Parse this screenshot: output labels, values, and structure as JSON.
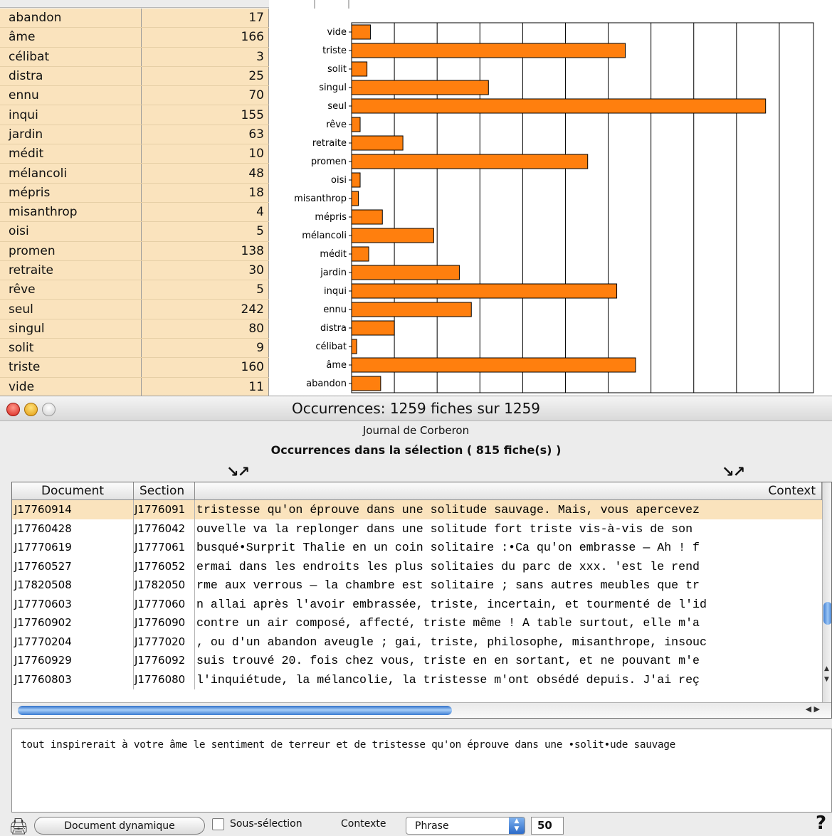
{
  "word_table": [
    {
      "word": "abandon",
      "count": "17"
    },
    {
      "word": "âme",
      "count": "166"
    },
    {
      "word": "célibat",
      "count": "3"
    },
    {
      "word": "distra",
      "count": "25"
    },
    {
      "word": "ennu",
      "count": "70"
    },
    {
      "word": "inqui",
      "count": "155"
    },
    {
      "word": "jardin",
      "count": "63"
    },
    {
      "word": "médit",
      "count": "10"
    },
    {
      "word": "mélancoli",
      "count": "48"
    },
    {
      "word": "mépris",
      "count": "18"
    },
    {
      "word": "misanthrop",
      "count": "4"
    },
    {
      "word": "oisi",
      "count": "5"
    },
    {
      "word": "promen",
      "count": "138"
    },
    {
      "word": "retraite",
      "count": "30"
    },
    {
      "word": "rêve",
      "count": "5"
    },
    {
      "word": "seul",
      "count": "242"
    },
    {
      "word": "singul",
      "count": "80"
    },
    {
      "word": "solit",
      "count": "9"
    },
    {
      "word": "triste",
      "count": "160"
    },
    {
      "word": "vide",
      "count": "11"
    }
  ],
  "chart_data": {
    "type": "bar",
    "orientation": "horizontal",
    "categories": [
      "vide",
      "triste",
      "solit",
      "singul",
      "seul",
      "rêve",
      "retraite",
      "promen",
      "oisi",
      "misanthrop",
      "mépris",
      "mélancoli",
      "médit",
      "jardin",
      "inqui",
      "ennu",
      "distra",
      "célibat",
      "âme",
      "abandon"
    ],
    "values": [
      11,
      160,
      9,
      80,
      242,
      5,
      30,
      138,
      5,
      4,
      18,
      48,
      10,
      63,
      155,
      70,
      25,
      3,
      166,
      17
    ],
    "xlim": [
      0,
      270
    ],
    "grid": true,
    "bar_color": "#ff7f0e"
  },
  "window": {
    "title": "Occurrences: 1259 fiches sur 1259",
    "subtitle": "Journal de Corberon",
    "heading": "Occurrences dans la sélection ( 815 fiche(s) )",
    "sort_arrows": "↘↗"
  },
  "grid": {
    "headers": {
      "document": "Document",
      "section": "Section",
      "context": "Context"
    },
    "rows": [
      {
        "document": "J17760914",
        "section": "J1776091",
        "context": "tristesse qu'on éprouve dans une solitude sauvage. Mais, vous apercevez"
      },
      {
        "document": "J17760428",
        "section": "J1776042",
        "context": "ouvelle va la replonger dans une solitude fort triste vis-à-vis de son"
      },
      {
        "document": "J17770619",
        "section": "J1777061",
        "context": "busqué•Surprit Thalie en un coin solitaire :•Ca qu'on embrasse — Ah ! f"
      },
      {
        "document": "J17760527",
        "section": "J1776052",
        "context": "ermai dans les endroits les plus solitaies du parc de xxx. 'est le rend"
      },
      {
        "document": "J17820508",
        "section": "J1782050",
        "context": "rme aux verrous — la chambre est solitaire ; sans autres meubles que tr"
      },
      {
        "document": "J17770603",
        "section": "J1777060",
        "context": "n allai après l'avoir embrassée, triste, incertain, et tourmenté de l'id"
      },
      {
        "document": "J17760902",
        "section": "J1776090",
        "context": " contre un air composé, affecté, triste même ! A table surtout, elle m'a"
      },
      {
        "document": "J17770204",
        "section": "J1777020",
        "context": ", ou d'un abandon aveugle ; gai, triste, philosophe, misanthrope, insouc"
      },
      {
        "document": "J17760929",
        "section": "J1776092",
        "context": " suis trouvé 20. fois chez vous, triste en en sortant, et ne pouvant m'e"
      },
      {
        "document": "J17760803",
        "section": "J1776080",
        "context": " l'inquiétude, la mélancolie, la tristesse m'ont obsédé depuis. J'ai reç"
      }
    ]
  },
  "context_text": "tout inspirerait à votre âme le sentiment de terreur et de tristesse qu'on éprouve dans une •solit•ude sauvage",
  "bottom_bar": {
    "print_icon": "printer-icon",
    "document_button": "Document dynamique",
    "subselection_label": "Sous-sélection",
    "context_label": "Contexte",
    "context_select_value": "Phrase",
    "context_size": "50",
    "help_label": "?"
  }
}
